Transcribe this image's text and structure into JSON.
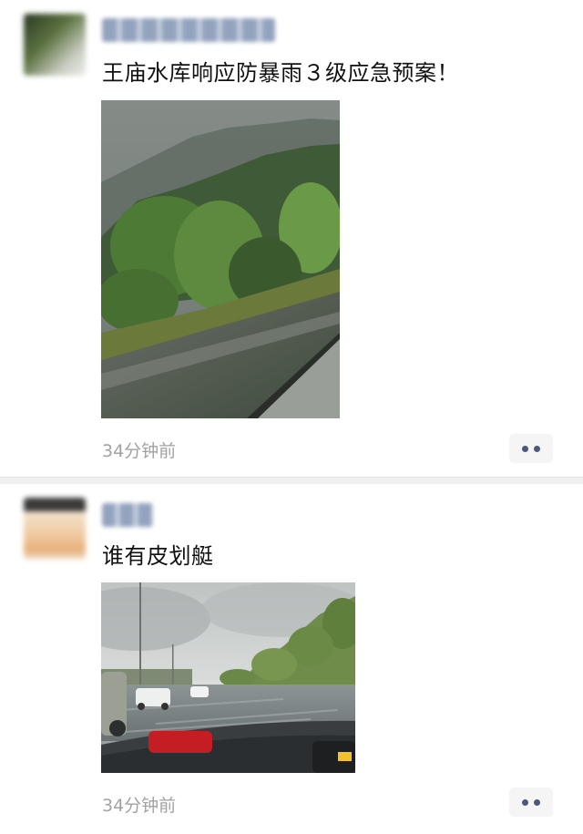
{
  "posts": [
    {
      "text": "王庙水库响应防暴雨３级应急预案！",
      "time": "34分钟前",
      "photo_icon": "misty-mountain-reservoir-photo",
      "more_icon": "more-dots-icon"
    },
    {
      "text": "谁有皮划艇",
      "time": "34分钟前",
      "photo_icon": "flooded-road-photo",
      "more_icon": "more-dots-icon"
    }
  ],
  "colors": {
    "text": "#111111",
    "timestamp": "#a2a2a2",
    "link_blue": "#4b5a7a",
    "divider": "#f0f0f0"
  }
}
